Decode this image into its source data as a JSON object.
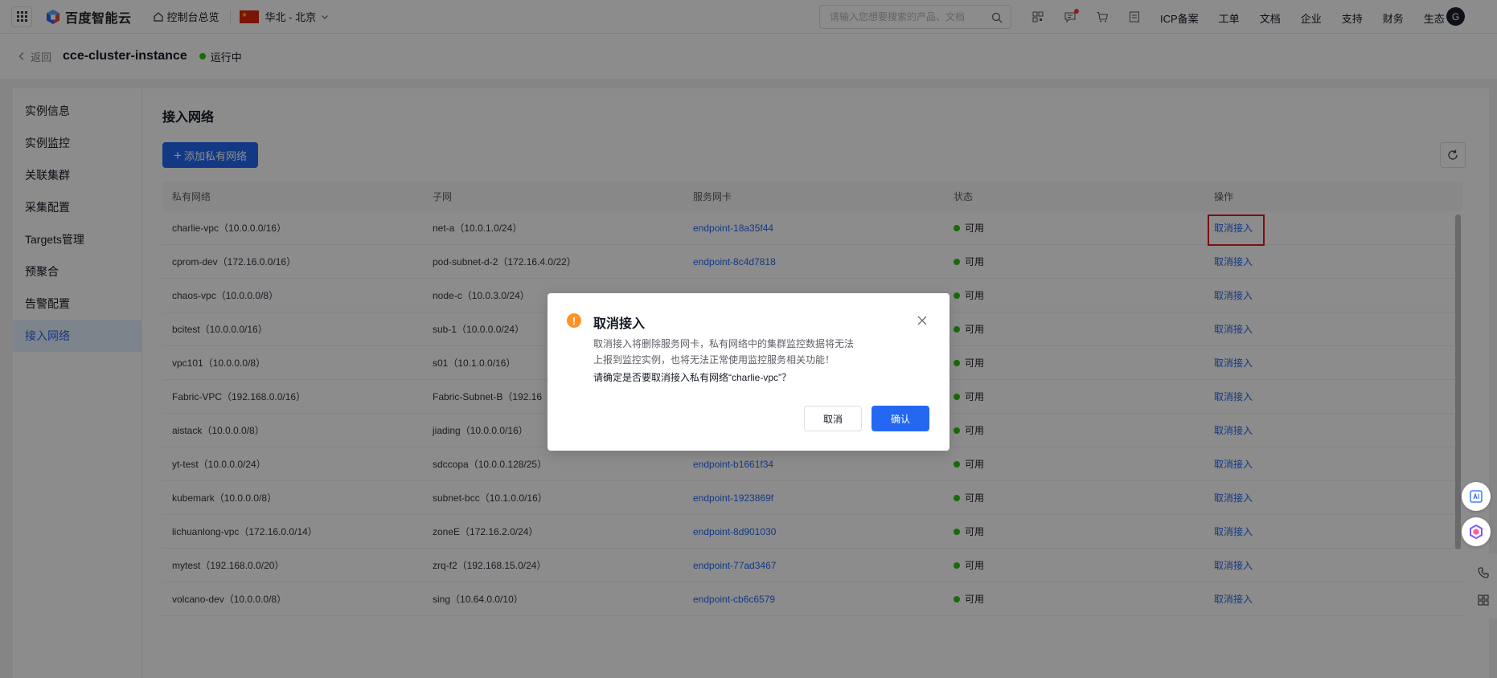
{
  "brand": {
    "name": "百度智能云"
  },
  "topbar": {
    "console_label": "控制台总览",
    "region_label": "华北 - 北京",
    "search_placeholder": "请输入您想要搜索的产品、文档",
    "menu": [
      "ICP备案",
      "工单",
      "文档",
      "企业",
      "支持",
      "财务",
      "生态"
    ],
    "avatar_letter": "G"
  },
  "breadcrumb": {
    "back_label": "返回",
    "instance_name": "cce-cluster-instance",
    "status": "运行中"
  },
  "sidebar": {
    "items": [
      {
        "label": "实例信息"
      },
      {
        "label": "实例监控"
      },
      {
        "label": "关联集群"
      },
      {
        "label": "采集配置"
      },
      {
        "label": "Targets管理"
      },
      {
        "label": "预聚合"
      },
      {
        "label": "告警配置"
      },
      {
        "label": "接入网络"
      }
    ],
    "active_index": 7
  },
  "main": {
    "section_title": "接入网络",
    "add_button_label": "添加私有网络",
    "columns": [
      "私有网络",
      "子网",
      "服务网卡",
      "状态",
      "操作"
    ],
    "rows": [
      {
        "vpc": "charlie-vpc（10.0.0.0/16）",
        "subnet": "net-a（10.0.1.0/24）",
        "endpoint": "endpoint-18a35f44",
        "status": "可用",
        "action": "取消接入"
      },
      {
        "vpc": "cprom-dev（172.16.0.0/16）",
        "subnet": "pod-subnet-d-2（172.16.4.0/22）",
        "endpoint": "endpoint-8c4d7818",
        "status": "可用",
        "action": "取消接入"
      },
      {
        "vpc": "chaos-vpc（10.0.0.0/8）",
        "subnet": "node-c（10.0.3.0/24）",
        "endpoint": "",
        "status": "可用",
        "action": "取消接入"
      },
      {
        "vpc": "bcitest（10.0.0.0/16）",
        "subnet": "sub-1（10.0.0.0/24）",
        "endpoint": "",
        "status": "可用",
        "action": "取消接入"
      },
      {
        "vpc": "vpc101（10.0.0.0/8）",
        "subnet": "s01（10.1.0.0/16）",
        "endpoint": "",
        "status": "可用",
        "action": "取消接入"
      },
      {
        "vpc": "Fabric-VPC（192.168.0.0/16）",
        "subnet": "Fabric-Subnet-B（192.16",
        "endpoint": "",
        "status": "可用",
        "action": "取消接入"
      },
      {
        "vpc": "aistack（10.0.0.0/8）",
        "subnet": "jiading（10.0.0.0/16）",
        "endpoint": "",
        "status": "可用",
        "action": "取消接入"
      },
      {
        "vpc": "yt-test（10.0.0.0/24）",
        "subnet": "sdccopa（10.0.0.128/25）",
        "endpoint": "endpoint-b1661f34",
        "status": "可用",
        "action": "取消接入"
      },
      {
        "vpc": "kubemark（10.0.0.0/8）",
        "subnet": "subnet-bcc（10.1.0.0/16）",
        "endpoint": "endpoint-1923869f",
        "status": "可用",
        "action": "取消接入"
      },
      {
        "vpc": "lichuanlong-vpc（172.16.0.0/14）",
        "subnet": "zoneE（172.16.2.0/24）",
        "endpoint": "endpoint-8d901030",
        "status": "可用",
        "action": "取消接入"
      },
      {
        "vpc": "mytest（192.168.0.0/20）",
        "subnet": "zrq-f2（192.168.15.0/24）",
        "endpoint": "endpoint-77ad3467",
        "status": "可用",
        "action": "取消接入"
      },
      {
        "vpc": "volcano-dev（10.0.0.0/8）",
        "subnet": "sing（10.64.0.0/10）",
        "endpoint": "endpoint-cb6c6579",
        "status": "可用",
        "action": "取消接入"
      }
    ]
  },
  "dialog": {
    "title": "取消接入",
    "body": "取消接入将删除服务网卡，私有网络中的集群监控数据将无法上报到监控实例，也将无法正常使用监控服务相关功能！",
    "confirm_text": "请确定是否要取消接入私有网络“charlie-vpc”？",
    "cancel_label": "取消",
    "ok_label": "确认"
  },
  "colors": {
    "primary": "#2468f2",
    "status_ok": "#30bf13",
    "warning": "#ff9326",
    "highlight": "#e02020"
  }
}
